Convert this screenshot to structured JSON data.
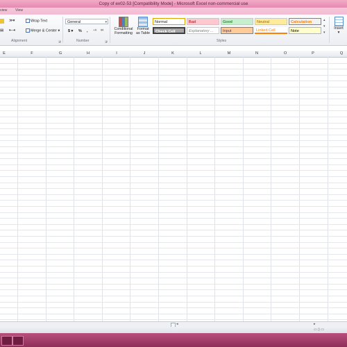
{
  "window": {
    "title": "Copy of ex02-53  [Compatibility Mode] - Microsoft Excel non-commercial use"
  },
  "tabs": [
    "view",
    "View"
  ],
  "ribbon": {
    "alignment": {
      "label": "Alignment",
      "wrap_text": "Wrap Text",
      "merge_center": "Merge & Center"
    },
    "number": {
      "label": "Number",
      "format_value": "General",
      "currency": "$",
      "percent": "%",
      "comma": ","
    },
    "styles": {
      "label": "Styles",
      "conditional_formatting": [
        "Conditional",
        "Formatting"
      ],
      "format_as_table": [
        "Format",
        "as Table"
      ],
      "cells": [
        {
          "label": "Normal",
          "bg": "#ffffff",
          "fg": "#000000"
        },
        {
          "label": "Bad",
          "bg": "#ffc7ce",
          "fg": "#9c0006"
        },
        {
          "label": "Good",
          "bg": "#c6efce",
          "fg": "#006100"
        },
        {
          "label": "Neutral",
          "bg": "#ffeb9c",
          "fg": "#9c6500"
        },
        {
          "label": "Calculation",
          "bg": "#f2f2f2",
          "fg": "#fa7d00"
        },
        {
          "label": "Check Cell",
          "bg": "#a5a5a5",
          "fg": "#ffffff"
        },
        {
          "label": "Explanatory ...",
          "bg": "#ffffff",
          "fg": "#7f7f7f"
        },
        {
          "label": "Input",
          "bg": "#ffcc99",
          "fg": "#3f3f76"
        },
        {
          "label": "Linked Cell",
          "bg": "#ffffff",
          "fg": "#fa7d00"
        },
        {
          "label": "Note",
          "bg": "#ffffcc",
          "fg": "#000000"
        }
      ]
    },
    "insert": "Insert"
  },
  "columns": [
    "E",
    "F",
    "G",
    "H",
    "I",
    "J",
    "K",
    "L",
    "M",
    "N",
    "O",
    "P",
    "Q"
  ]
}
